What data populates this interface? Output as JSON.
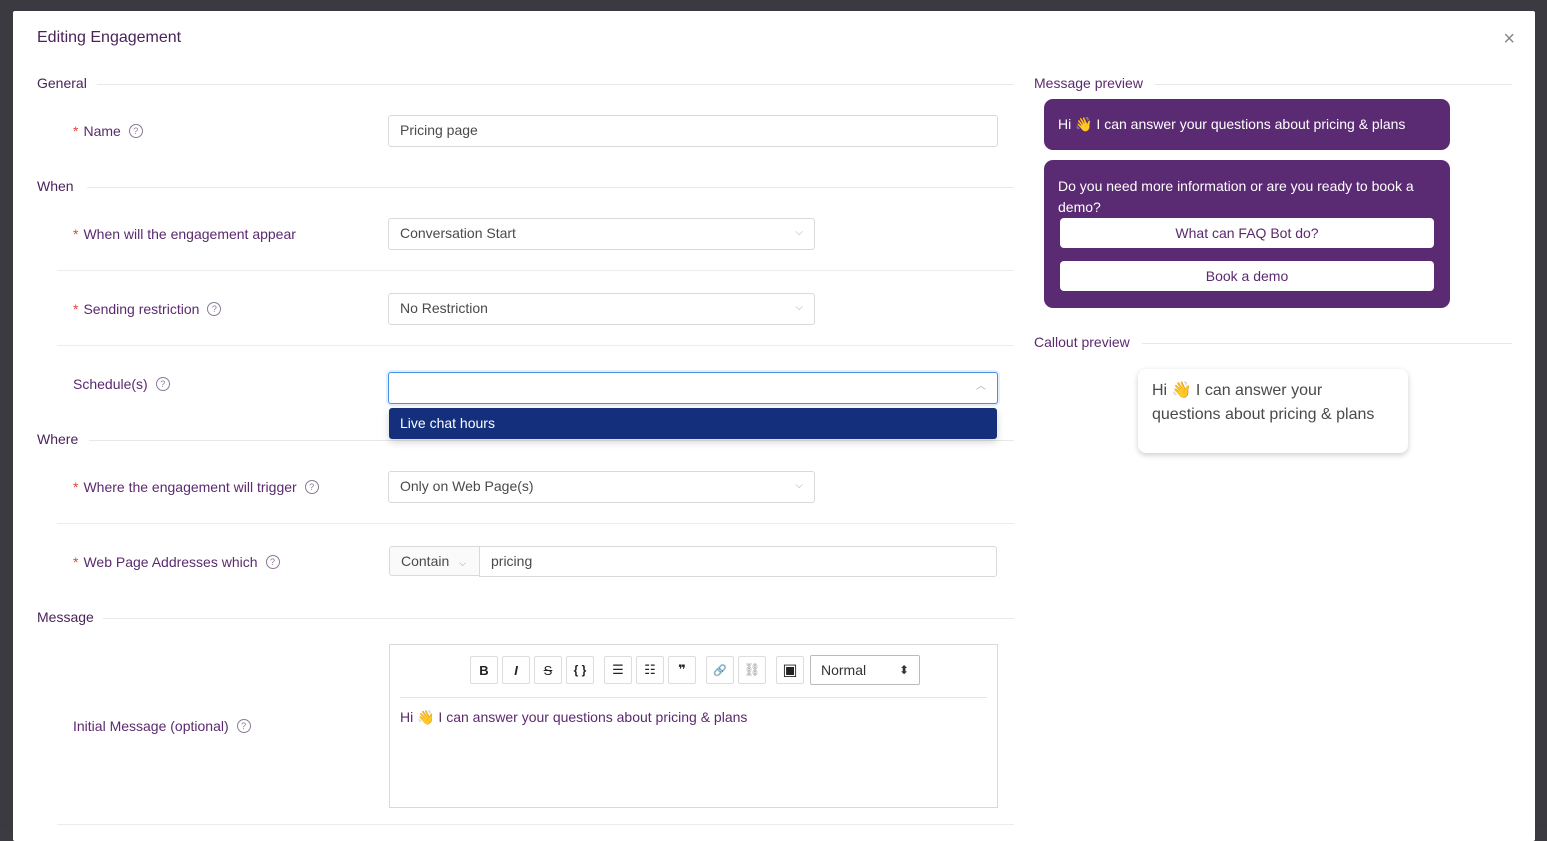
{
  "modal": {
    "title": "Editing Engagement",
    "close": "×"
  },
  "sections": {
    "general": "General",
    "when": "When",
    "where": "Where",
    "message": "Message"
  },
  "fields": {
    "name": {
      "label": "Name",
      "value": "Pricing page"
    },
    "appear": {
      "label": "When will the engagement appear",
      "value": "Conversation Start"
    },
    "restriction": {
      "label": "Sending restriction",
      "value": "No Restriction"
    },
    "schedules": {
      "label": "Schedule(s)",
      "value": "",
      "options": [
        "Live chat hours"
      ]
    },
    "trigger": {
      "label": "Where the engagement will trigger",
      "value": "Only on Web Page(s)"
    },
    "addresses": {
      "label": "Web Page Addresses which",
      "operator": "Contain",
      "value": "pricing"
    },
    "initial_message": {
      "label": "Initial Message (optional)",
      "value": "Hi 👋 I can answer your questions about pricing & plans"
    }
  },
  "editor": {
    "bold": "B",
    "italic": "I",
    "strike": "S",
    "code": "{ }",
    "bullet_list": "☰",
    "ordered_list": "☷",
    "quote": "❞",
    "link": "🔗",
    "unlink": "⛓",
    "image": "▣",
    "format": "Normal",
    "format_arrows": "⬍"
  },
  "preview": {
    "message_label": "Message preview",
    "bubble1": "Hi 👋 I can answer your questions about pricing & plans",
    "bubble2": "Do you need more information or are you ready to book a demo?",
    "buttons": [
      "What can FAQ Bot do?",
      "Book a demo"
    ],
    "callout_label": "Callout preview",
    "callout_text": "Hi 👋 I can answer your questions about pricing & plans"
  },
  "glyphs": {
    "required": "*",
    "help": "?",
    "chevron_down": "⌵",
    "chevron_up": "︿"
  },
  "colors": {
    "brand": "#5a2a72",
    "dropdown_selected": "#14307d",
    "required": "#e0453c"
  }
}
